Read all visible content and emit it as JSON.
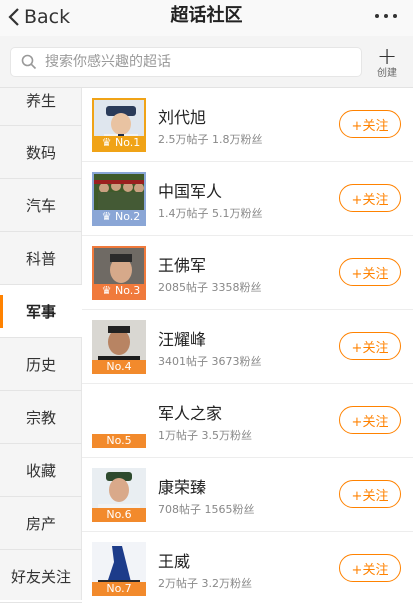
{
  "header": {
    "back_label": "Back",
    "title": "超话社区"
  },
  "search": {
    "placeholder": "搜索你感兴趣的超话",
    "create_label": "创建"
  },
  "sidebar": {
    "items": [
      {
        "label": "养生"
      },
      {
        "label": "数码"
      },
      {
        "label": "汽车"
      },
      {
        "label": "科普"
      },
      {
        "label": "军事"
      },
      {
        "label": "历史"
      },
      {
        "label": "宗教"
      },
      {
        "label": "收藏"
      },
      {
        "label": "房产"
      },
      {
        "label": "好友关注"
      }
    ],
    "active": "军事"
  },
  "list": {
    "follow_label": "+关注",
    "rows": [
      {
        "name": "刘代旭",
        "stats": "2.5万帖子 1.8万粉丝",
        "rank": "No.1",
        "rank_color": "#f0a317"
      },
      {
        "name": "中国军人",
        "stats": "1.4万帖子 5.1万粉丝",
        "rank": "No.2",
        "rank_color": "#8aa6d6"
      },
      {
        "name": "王佛军",
        "stats": "2085帖子 3358粉丝",
        "rank": "No.3",
        "rank_color": "#f07a3c"
      },
      {
        "name": "汪耀峰",
        "stats": "3401帖子 3673粉丝",
        "rank": "No.4",
        "rank_color": "#f28a2c"
      },
      {
        "name": "军人之家",
        "stats": "1万帖子 3.5万粉丝",
        "rank": "No.5",
        "rank_color": "#f28a2c"
      },
      {
        "name": "康荣臻",
        "stats": "708帖子 1565粉丝",
        "rank": "No.6",
        "rank_color": "#f28a2c"
      },
      {
        "name": "王威",
        "stats": "2万帖子 3.2万粉丝",
        "rank": "No.7",
        "rank_color": "#f28a2c"
      }
    ]
  },
  "colors": {
    "accent": "#ff8200"
  }
}
